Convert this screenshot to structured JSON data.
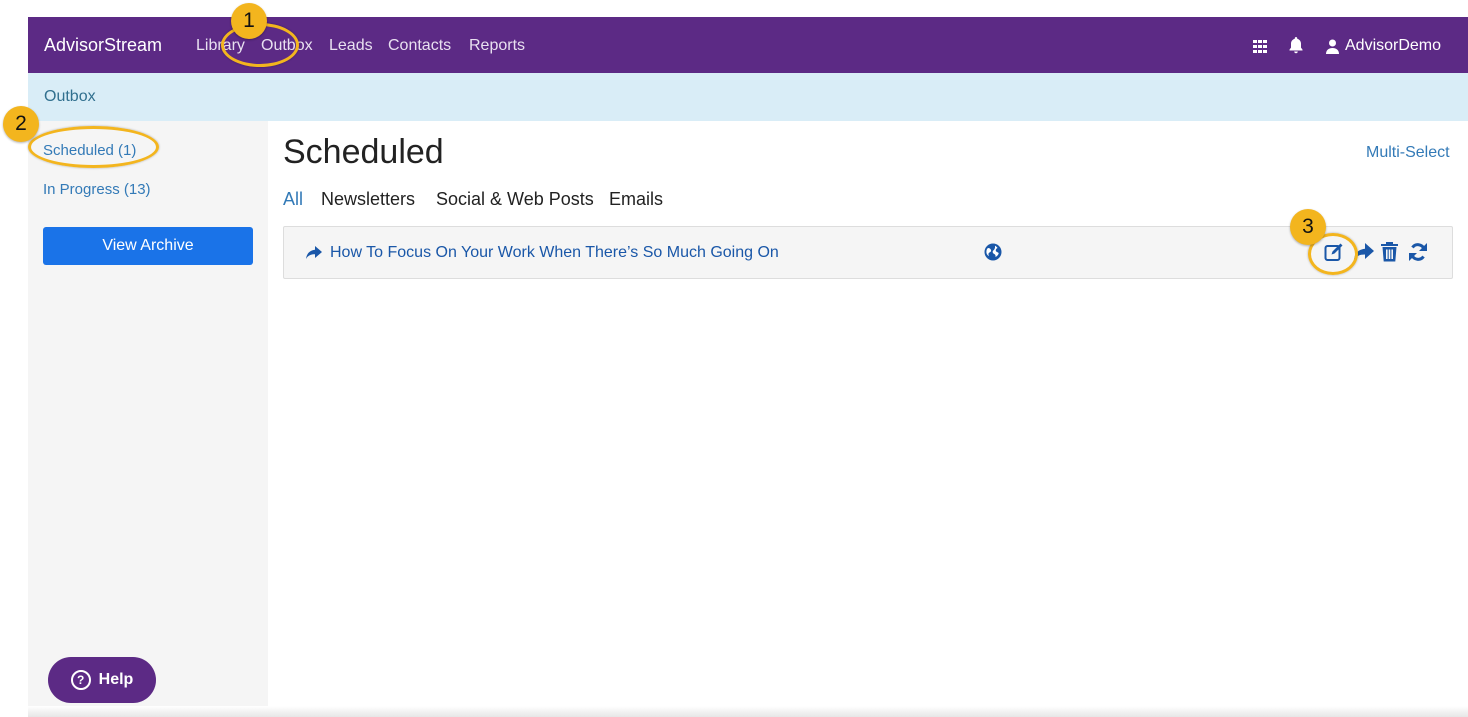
{
  "nav": {
    "brand": "AdvisorStream",
    "links": [
      "Library",
      "Outbox",
      "Leads",
      "Contacts",
      "Reports"
    ],
    "user": "AdvisorDemo",
    "icons": [
      "apps-grid-icon",
      "bell-icon",
      "user-icon"
    ]
  },
  "breadcrumb": "Outbox",
  "sidebar": {
    "items": [
      "Scheduled (1)",
      "In Progress (13)"
    ],
    "archive_button": "View Archive",
    "help_button": "Help"
  },
  "main": {
    "title": "Scheduled",
    "multi_select": "Multi-Select",
    "tabs": [
      "All",
      "Newsletters",
      "Social & Web Posts",
      "Emails"
    ],
    "active_tab": "All",
    "items": [
      {
        "title": "How To Focus On Your Work When There’s So Much Going On",
        "actions": [
          "edit-icon",
          "share-icon",
          "trash-icon",
          "refresh-icon"
        ]
      }
    ]
  },
  "annotations": [
    "1",
    "2",
    "3"
  ],
  "colors": {
    "nav_bg": "#5c2a85",
    "breadcrumb_bg": "#d9edf7",
    "link": "#337ab7",
    "primary_button": "#1a73e8",
    "highlight": "#f3b51e"
  }
}
